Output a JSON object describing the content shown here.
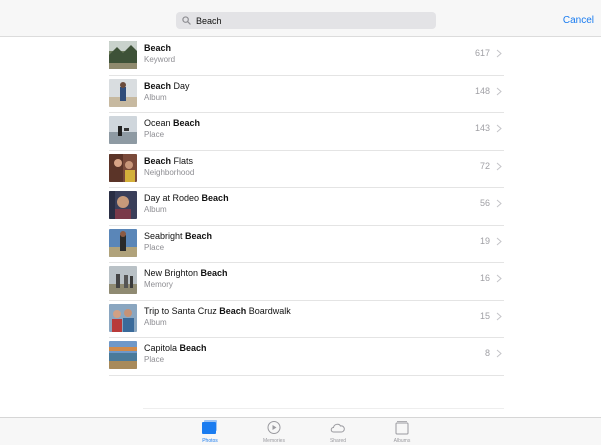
{
  "search": {
    "value": "Beach",
    "cancel_label": "Cancel"
  },
  "results": [
    {
      "pre": "",
      "bold": "Beach",
      "post": "",
      "type": "Keyword",
      "count": "617"
    },
    {
      "pre": "",
      "bold": "Beach",
      "post": " Day",
      "type": "Album",
      "count": "148"
    },
    {
      "pre": "Ocean ",
      "bold": "Beach",
      "post": "",
      "type": "Place",
      "count": "143"
    },
    {
      "pre": "",
      "bold": "Beach",
      "post": " Flats",
      "type": "Neighborhood",
      "count": "72"
    },
    {
      "pre": "Day at Rodeo ",
      "bold": "Beach",
      "post": "",
      "type": "Album",
      "count": "56"
    },
    {
      "pre": "Seabright ",
      "bold": "Beach",
      "post": "",
      "type": "Place",
      "count": "19"
    },
    {
      "pre": "New Brighton ",
      "bold": "Beach",
      "post": "",
      "type": "Memory",
      "count": "16"
    },
    {
      "pre": "Trip to Santa Cruz ",
      "bold": "Beach",
      "post": " Boardwalk",
      "type": "Album",
      "count": "15"
    },
    {
      "pre": "Capitola ",
      "bold": "Beach",
      "post": "",
      "type": "Place",
      "count": "8"
    }
  ],
  "tabs": [
    {
      "label": "Photos",
      "icon": "photos-icon",
      "active": true
    },
    {
      "label": "Memories",
      "icon": "memories-icon",
      "active": false
    },
    {
      "label": "Shared",
      "icon": "cloud-icon",
      "active": false
    },
    {
      "label": "Albums",
      "icon": "albums-icon",
      "active": false
    }
  ],
  "colors": {
    "accent": "#1a7cf0",
    "secondary_text": "#8e8e93"
  }
}
